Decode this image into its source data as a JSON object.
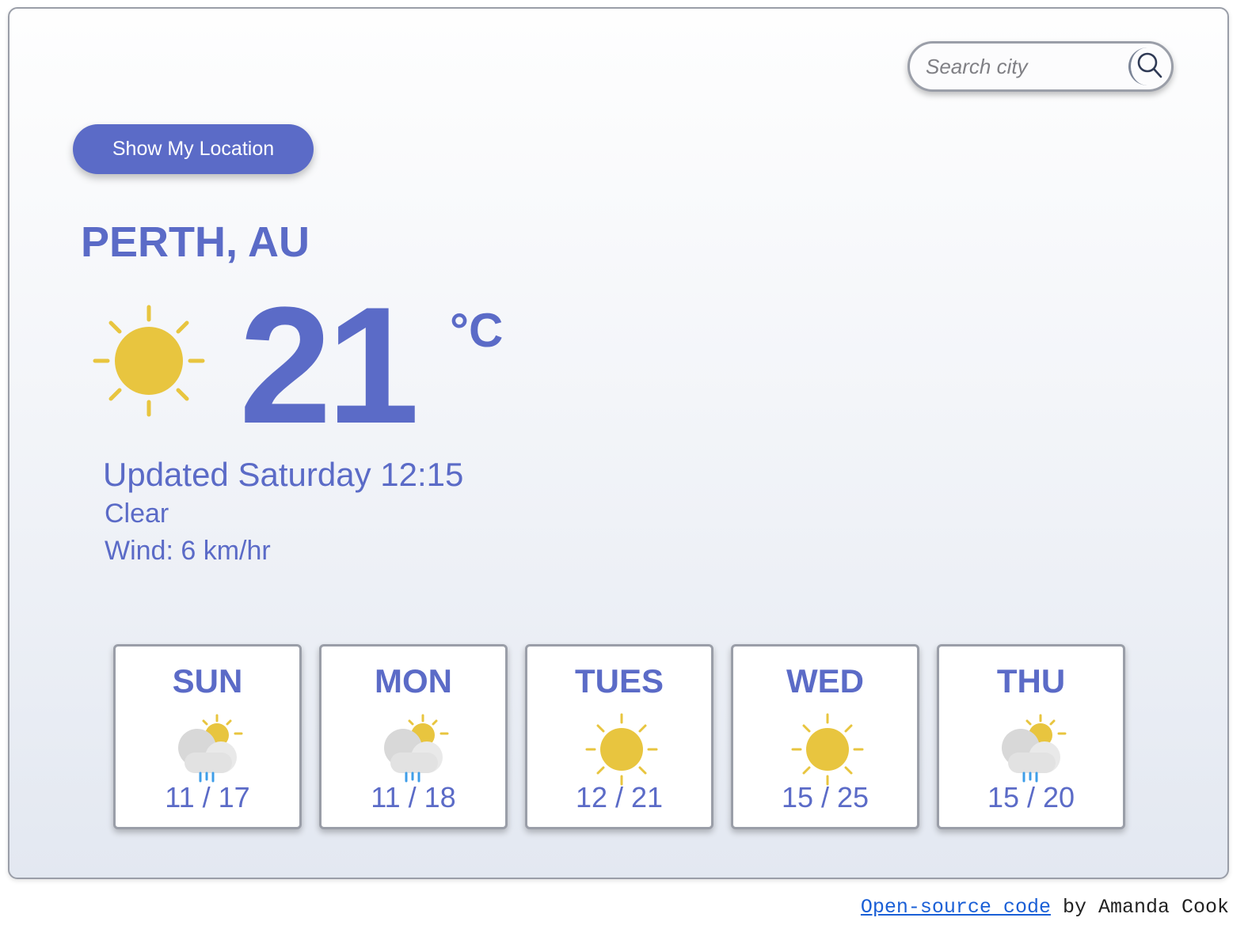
{
  "search": {
    "placeholder": "Search city"
  },
  "location_button": {
    "label": "Show My Location"
  },
  "current": {
    "city": "PERTH, AU",
    "icon": "sun-icon",
    "temperature": "21",
    "unit": "°C",
    "updated": "Updated Saturday 12:15",
    "description": "Clear",
    "wind": "Wind: 6 km/hr"
  },
  "forecast": [
    {
      "day": "SUN",
      "icon": "partly-cloudy-rain-icon",
      "temps": "11 / 17"
    },
    {
      "day": "MON",
      "icon": "partly-cloudy-rain-icon",
      "temps": "11 / 18"
    },
    {
      "day": "TUES",
      "icon": "sun-icon",
      "temps": "12 / 21"
    },
    {
      "day": "WED",
      "icon": "sun-icon",
      "temps": "15 / 25"
    },
    {
      "day": "THU",
      "icon": "partly-cloudy-rain-icon",
      "temps": "15 / 20"
    }
  ],
  "footer": {
    "link_text": "Open-source code",
    "suffix": " by Amanda Cook"
  },
  "colors": {
    "accent": "#5b6bc7",
    "sun": "#e8c53f",
    "rain": "#3f9ee8",
    "border": "#9a9ea8"
  }
}
